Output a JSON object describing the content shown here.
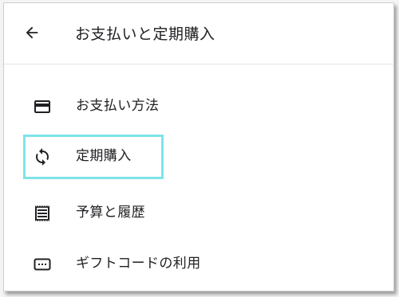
{
  "header": {
    "back_icon": "arrow-left-icon",
    "title": "お支払いと定期購入"
  },
  "menu": {
    "items": [
      {
        "label": "お支払い方法",
        "icon": "credit-card-icon"
      },
      {
        "label": "定期購入",
        "icon": "sync-icon",
        "highlighted": true,
        "highlight_color": "#7ee3ea"
      },
      {
        "label": "予算と履歴",
        "icon": "receipt-icon"
      },
      {
        "label": "ギフトコードの利用",
        "icon": "redeem-code-icon"
      }
    ]
  }
}
